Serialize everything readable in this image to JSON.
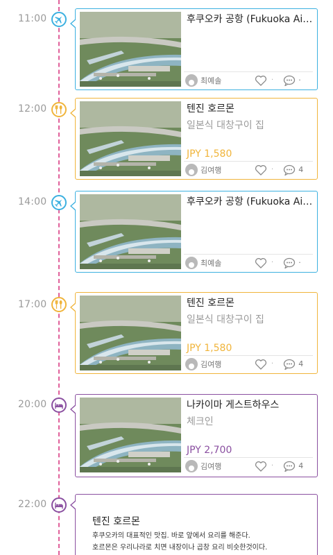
{
  "colors": {
    "flight": "#3bb0e0",
    "food": "#f0b43a",
    "hotel": "#8a4fa0",
    "timeline": "#e0609a"
  },
  "entries": [
    {
      "time": "11:00",
      "category": "flight",
      "icon": "airplane-icon",
      "title": "후쿠오카 공항 (Fukuoka Airp...",
      "subtitle": "",
      "price": "",
      "author": "최예솔",
      "comments": ""
    },
    {
      "time": "12:00",
      "category": "food",
      "icon": "fork-spoon-icon",
      "title": "텐진 호르몬",
      "subtitle": "일본식 대창구이 집",
      "price": "JPY 1,580",
      "author": "김여행",
      "comments": "4"
    },
    {
      "time": "14:00",
      "category": "flight",
      "icon": "airplane-icon",
      "title": "후쿠오카 공항 (Fukuoka Airp...",
      "subtitle": "",
      "price": "",
      "author": "최예솔",
      "comments": ""
    },
    {
      "time": "17:00",
      "category": "food",
      "icon": "fork-spoon-icon",
      "title": "텐진 호르몬",
      "subtitle": "일본식 대창구이 집",
      "price": "JPY 1,580",
      "author": "김여행",
      "comments": "4"
    },
    {
      "time": "20:00",
      "category": "hotel",
      "icon": "bed-icon",
      "title": "나카이마 게스트하우스",
      "subtitle": "체크인",
      "price": "JPY 2,700",
      "author": "김여행",
      "comments": "4"
    }
  ],
  "note": {
    "time": "22:00",
    "category": "hotel",
    "icon": "bed-icon",
    "title": "텐진 호르몬",
    "lines": [
      "후쿠오카의 대표적인 맛집. 바로 앞에서 요리를 해준다.",
      "호르몬은 우리나라로 치면 내장이나 곱창 요리 비슷한것이다."
    ]
  },
  "footer_separator": "·"
}
